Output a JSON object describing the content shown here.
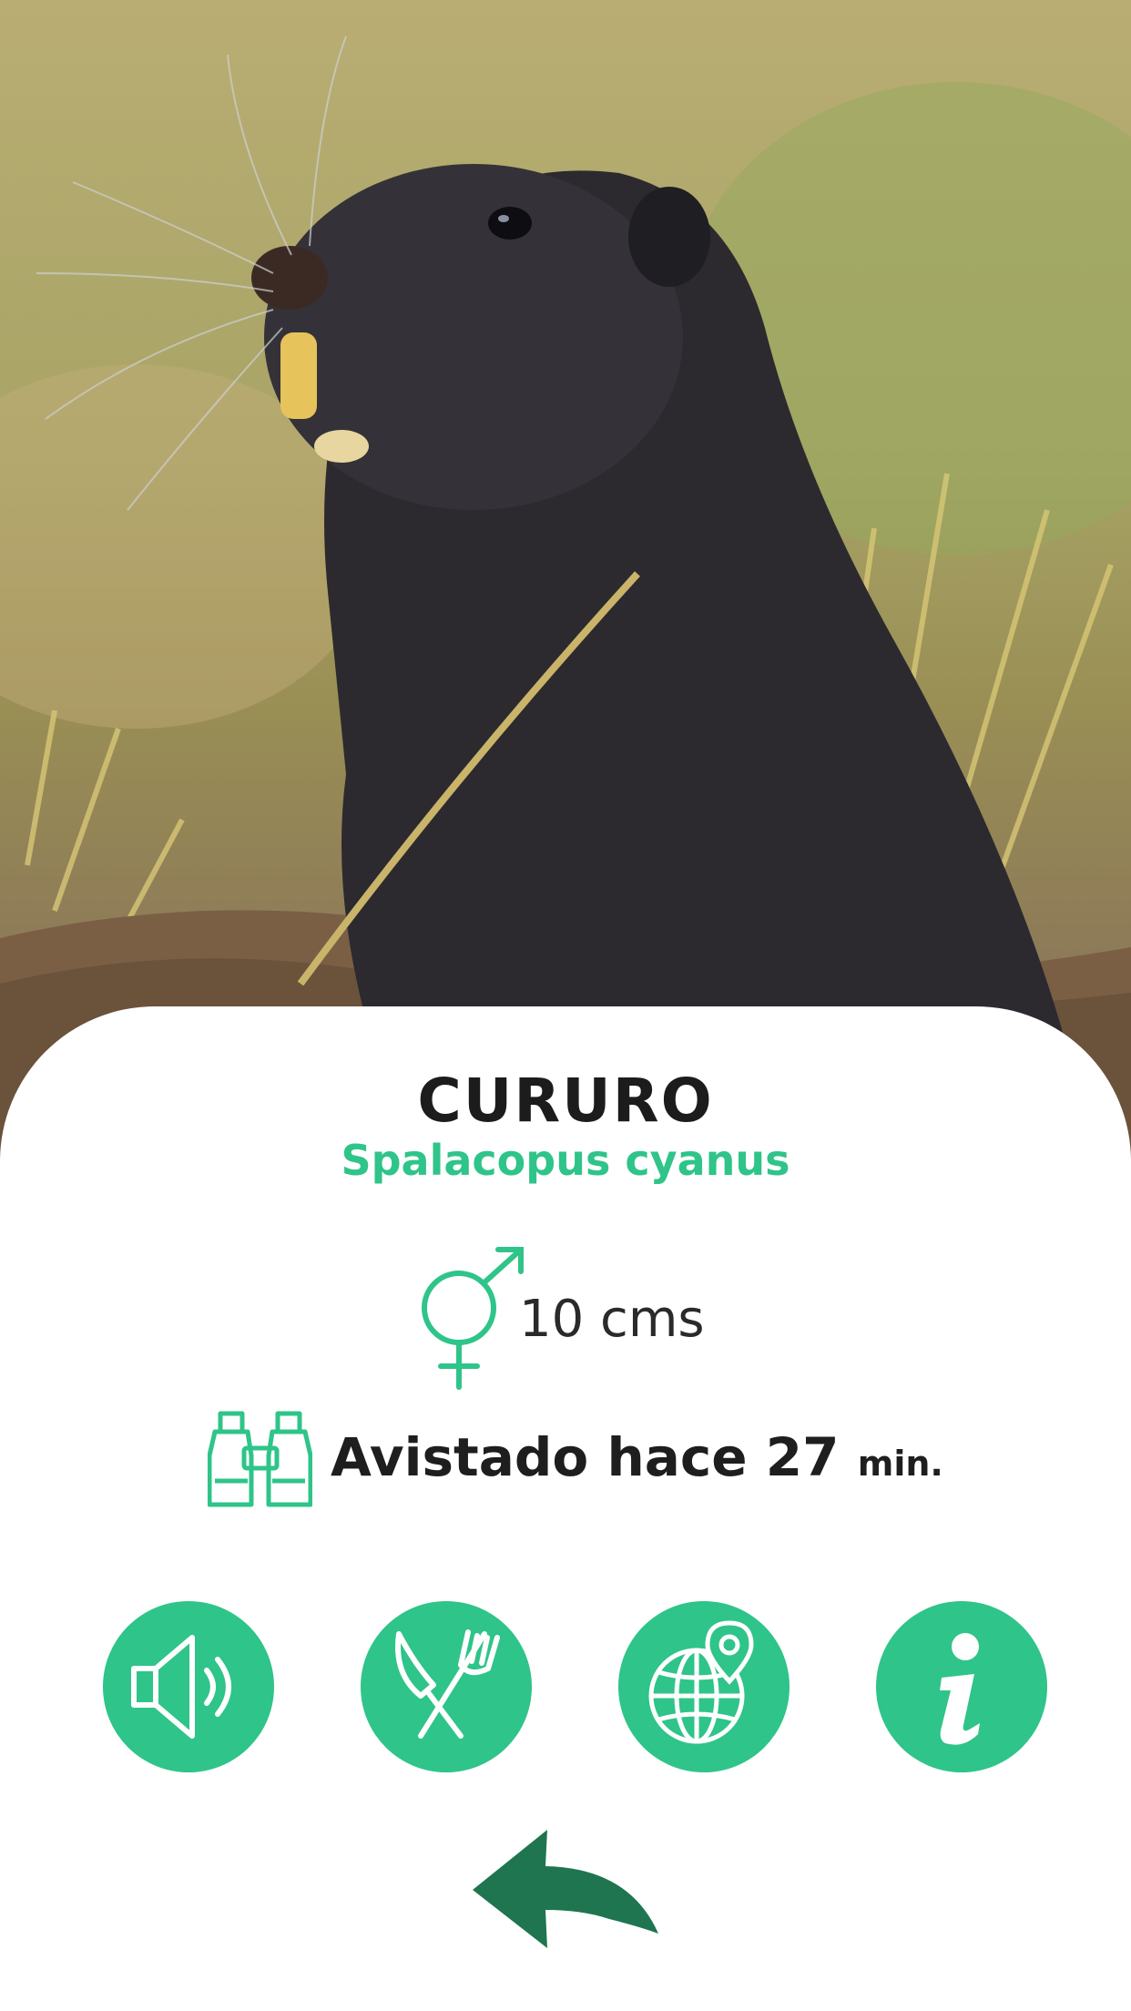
{
  "species": {
    "common_name": "CURURO",
    "scientific_name": "Spalacopus cyanus"
  },
  "size": {
    "icon": "gender-male-female-icon",
    "value": "10 cms"
  },
  "sighting": {
    "icon": "binoculars-icon",
    "text": "Avistado hace 27",
    "unit": "min."
  },
  "actions": [
    {
      "name": "sound",
      "icon": "speaker-icon"
    },
    {
      "name": "diet",
      "icon": "knife-fork-icon"
    },
    {
      "name": "location",
      "icon": "globe-location-icon"
    },
    {
      "name": "info",
      "icon": "info-icon"
    }
  ],
  "navigation": {
    "back_icon": "back-arrow-icon"
  },
  "colors": {
    "accent": "#2fc489",
    "back_arrow": "#1e7550",
    "title": "#1c1c1c"
  }
}
